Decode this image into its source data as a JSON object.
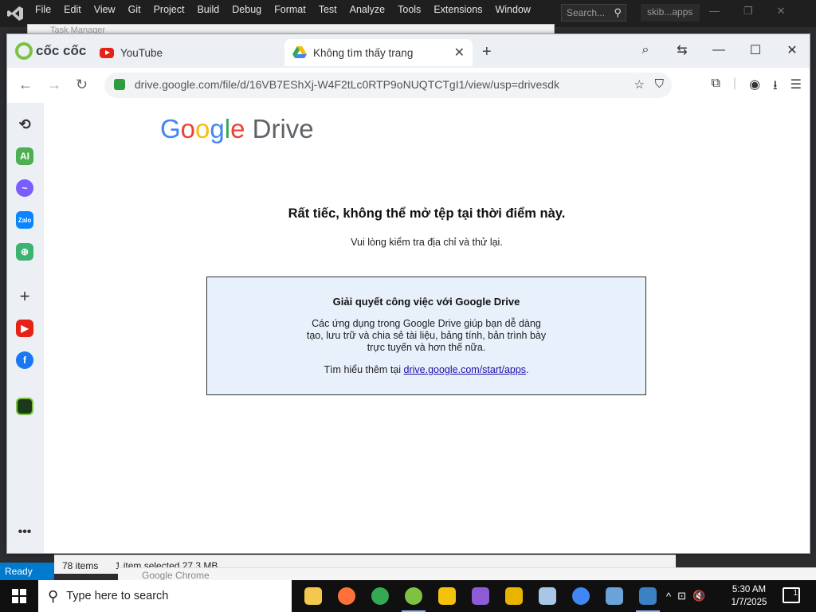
{
  "vs": {
    "menu": [
      "File",
      "Edit",
      "View",
      "Git",
      "Project",
      "Build",
      "Debug",
      "Format",
      "Test",
      "Analyze",
      "Tools",
      "Extensions",
      "Window"
    ],
    "search_placeholder": "Search...",
    "solution_name": "skib...apps",
    "status": "Ready"
  },
  "background_window": {
    "title": "Task Manager"
  },
  "browser": {
    "brand": "cốc cốc",
    "tabs": [
      {
        "label": "YouTube",
        "icon": "youtube-icon"
      },
      {
        "label": "Không tìm thấy trang",
        "icon": "google-drive-icon",
        "active": true
      }
    ],
    "url": "drive.google.com/file/d/16VB7EShXj-W4F2tLc0RTP9oNUQTCTgI1/view/usp=drivesdk",
    "sidebar_icons": [
      "history-icon",
      "ai-icon",
      "messenger-icon",
      "zalo-icon",
      "game-icon",
      "add-icon",
      "youtube-icon",
      "facebook-icon",
      "coccoc-2024-icon",
      "more-icon"
    ]
  },
  "page": {
    "logo_google": "Google",
    "logo_drive": "Drive",
    "error_title": "Rất tiếc, không thể mở tệp tại thời điểm này.",
    "error_subtitle": "Vui lòng kiểm tra địa chỉ và thử lại.",
    "box_title": "Giải quyết công việc với Google Drive",
    "box_body": "Các ứng dụng trong Google Drive giúp bạn dễ dàng tạo, lưu trữ và chia sẻ tài liệu, bảng tính, bản trình bày trực tuyến và hơn thế nữa.",
    "box_learn_prefix": "Tìm hiểu thêm tại ",
    "box_learn_link": "drive.google.com/start/apps",
    "box_learn_suffix": "."
  },
  "explorer": {
    "items": "78 items",
    "selected": "1 item selected  27.3 MB"
  },
  "chrome_remnant": "Google Chrome",
  "taskbar": {
    "search_placeholder": "Type here to search",
    "time": "5:30 AM",
    "date": "1/7/2025",
    "notifications": "1",
    "apps": [
      {
        "name": "file-explorer-icon",
        "color": "#f2c94c"
      },
      {
        "name": "firefox-icon",
        "color": "#ff7139"
      },
      {
        "name": "chrome-icon",
        "color": "#34a853"
      },
      {
        "name": "coccoc-icon",
        "color": "#7dc243"
      },
      {
        "name": "sticky-app-icon",
        "color": "#f4c20d"
      },
      {
        "name": "visual-studio-icon",
        "color": "#8e5bd6"
      },
      {
        "name": "android-studio-icon",
        "color": "#e8b400"
      },
      {
        "name": "network-drive-icon",
        "color": "#a8c7e6"
      },
      {
        "name": "chrome-icon",
        "color": "#4285f4"
      },
      {
        "name": "network-tool-icon",
        "color": "#6aa3d8"
      },
      {
        "name": "python-app-icon",
        "color": "#3b82c4"
      }
    ]
  }
}
